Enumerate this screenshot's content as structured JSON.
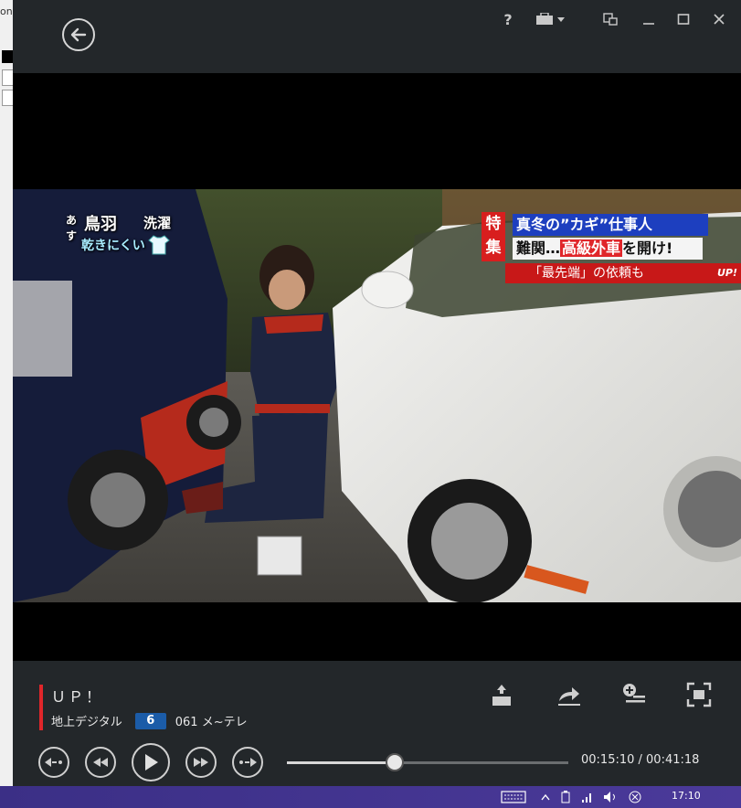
{
  "behind_window": {
    "text": "on"
  },
  "titlebar": {
    "help_label": "?"
  },
  "broadcast": {
    "weather": {
      "city": "鳥羽",
      "hint": "あす",
      "category": "洗濯",
      "advice": "乾きにくい"
    },
    "telop": {
      "special_label": "特集",
      "headline1": "真冬の”カギ”仕事人",
      "headline2_prefix": "難関…",
      "headline2_highlight": "高級外車",
      "headline2_suffix": "を開け!",
      "subline": "「最先端」の依頼も",
      "brand": "UP!"
    }
  },
  "program": {
    "title": "ＵＰ！",
    "source": "地上デジタル",
    "channel_logo": "6",
    "channel": "061 メ~テレ"
  },
  "playback": {
    "position": 0.383,
    "time": "00:15:10 / 00:41:18"
  },
  "taskbar": {
    "clock": "17:10"
  },
  "colors": {
    "accent": "#e0262a",
    "taskbar": "#3b2f86"
  }
}
